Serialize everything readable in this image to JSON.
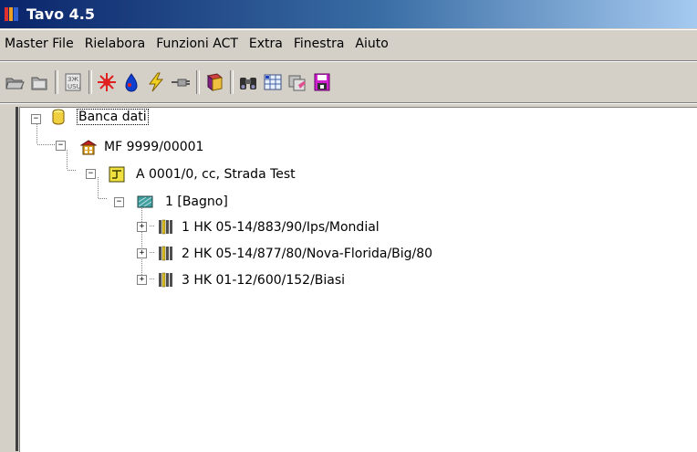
{
  "window": {
    "title": "Tavo 4.5"
  },
  "menu": [
    "Master File",
    "Rielabora",
    "Funzioni ACT",
    "Extra",
    "Finestra",
    "Aiuto"
  ],
  "toolbar": {
    "icons": [
      "open-folder-icon",
      "folder-icon",
      "units-icon",
      "sun-icon",
      "blue-drop-icon",
      "lightning-icon",
      "plug-icon",
      "book-icon",
      "binoculars-icon",
      "spreadsheet-icon",
      "copy-icon",
      "save-disk-icon"
    ]
  },
  "tree": {
    "root": {
      "label": "Banca dati",
      "expanded": true,
      "selected": true,
      "icon": "database-icon"
    },
    "master_file": {
      "label": "MF 9999/00001",
      "expanded": true,
      "icon": "building-icon"
    },
    "apartment": {
      "label": "A 0001/0, cc, Strada Test",
      "expanded": true,
      "icon": "floorplan-icon"
    },
    "room": {
      "label": "1 [Bagno]",
      "expanded": true,
      "icon": "room-icon"
    },
    "radiators": [
      {
        "label": "1 HK 05-14/883/90/Ips/Mondial",
        "expanded": false,
        "icon": "radiator-icon"
      },
      {
        "label": "2 HK 05-14/877/80/Nova-Florida/Big/80",
        "expanded": false,
        "icon": "radiator-icon"
      },
      {
        "label": "3 HK 01-12/600/152/Biasi",
        "expanded": false,
        "icon": "radiator-icon"
      }
    ]
  },
  "colors": {
    "titlebar_start": "#0a246a",
    "titlebar_end": "#a6caf0",
    "chrome": "#d4d0c8"
  }
}
